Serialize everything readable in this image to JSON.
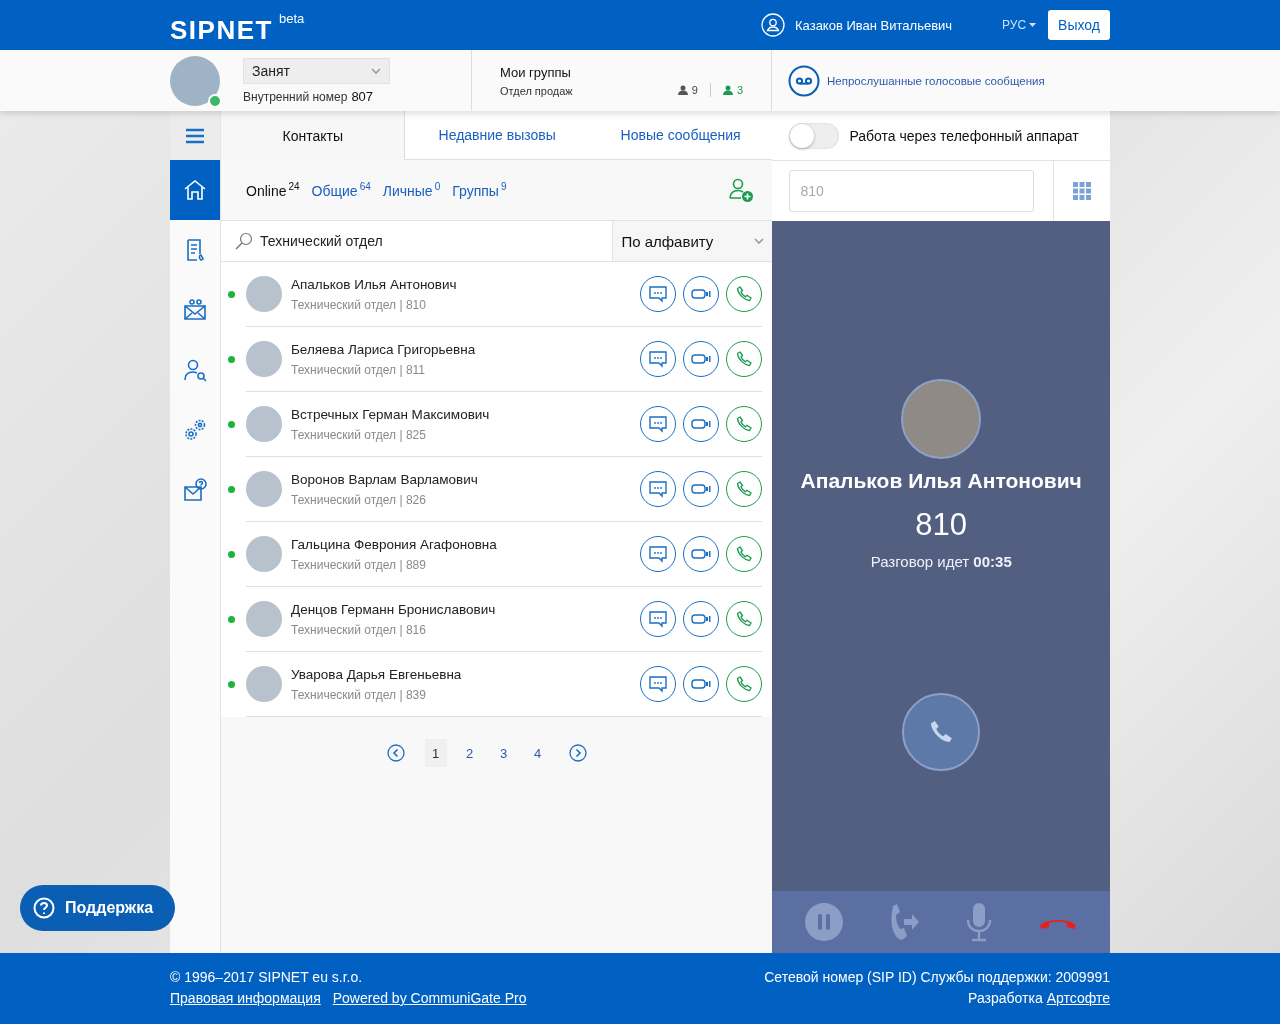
{
  "header": {
    "logo": "SIPNET",
    "logo_badge": "beta",
    "user_name": "Казаков Иван Витальевич",
    "language": "РУС",
    "logout": "Выход"
  },
  "profile": {
    "status": "Занят",
    "extension_label": "Внутренний номер",
    "extension": "807",
    "online": true
  },
  "groups": {
    "title": "Мои группы",
    "name": "Отдел продаж",
    "total": "9",
    "online": "3"
  },
  "voicemail": {
    "label": "Непрослушанные голосовые сообщения"
  },
  "sidebar": {
    "items": [
      {
        "kind": "menu",
        "selected": false
      },
      {
        "kind": "home",
        "selected": true
      },
      {
        "kind": "document",
        "selected": false
      },
      {
        "kind": "mail",
        "selected": false
      },
      {
        "kind": "user-search",
        "selected": false
      },
      {
        "kind": "gears",
        "selected": false
      },
      {
        "kind": "mail-help",
        "selected": false
      }
    ]
  },
  "tabs": [
    {
      "label": "Контакты",
      "selected": true
    },
    {
      "label": "Недавние вызовы",
      "selected": false
    },
    {
      "label": "Новые сообщения",
      "selected": false
    }
  ],
  "filters": [
    {
      "label": "Online",
      "count": "24",
      "selected": true
    },
    {
      "label": "Общие",
      "count": "64",
      "selected": false
    },
    {
      "label": "Личные",
      "count": "0",
      "selected": false
    },
    {
      "label": "Группы",
      "count": "9",
      "selected": false
    }
  ],
  "search": {
    "value": "Технический отдел"
  },
  "sort": {
    "value": "По алфавиту"
  },
  "contacts": [
    {
      "name": "Апальков Илья Антонович",
      "subtitle": "Технический отдел | 810",
      "online": true
    },
    {
      "name": "Беляева Лариса Григорьевна",
      "subtitle": "Технический отдел | 811",
      "online": true
    },
    {
      "name": "Встречных Герман Максимович",
      "subtitle": "Технический отдел | 825",
      "online": true
    },
    {
      "name": "Воронов Варлам Варламович",
      "subtitle": "Технический отдел | 826",
      "online": true
    },
    {
      "name": "Гальцина Феврония Агафоновна",
      "subtitle": "Технический отдел | 889",
      "online": true
    },
    {
      "name": "Денцов Германн Брониславович",
      "subtitle": "Технический отдел | 816",
      "online": true
    },
    {
      "name": "Уварова Дарья Евгеньевна",
      "subtitle": "Технический отдел | 839",
      "online": true
    }
  ],
  "pagination": [
    {
      "label": "1",
      "selected": true
    },
    {
      "label": "2",
      "selected": false
    },
    {
      "label": "3",
      "selected": false
    },
    {
      "label": "4",
      "selected": false
    }
  ],
  "phone_mode": {
    "label": "Работа через телефонный аппарат",
    "on": false
  },
  "dial": {
    "placeholder": "810"
  },
  "call": {
    "name": "Апальков Илья Антонович",
    "number": "810",
    "status": "Разговор идет **00:35**"
  },
  "support": {
    "label": "Поддержка"
  },
  "footer": {
    "copyright": "© 1996–2017 SIPNET eu s.r.o.",
    "links": [
      "Правовая информация",
      "Powered by CommuniGate Pro"
    ],
    "support_id": "Сетевой номер (SIP ID) Службы поддержки: 2009991",
    "developer_label": "Разработка",
    "developer_link": "Артсофте"
  }
}
